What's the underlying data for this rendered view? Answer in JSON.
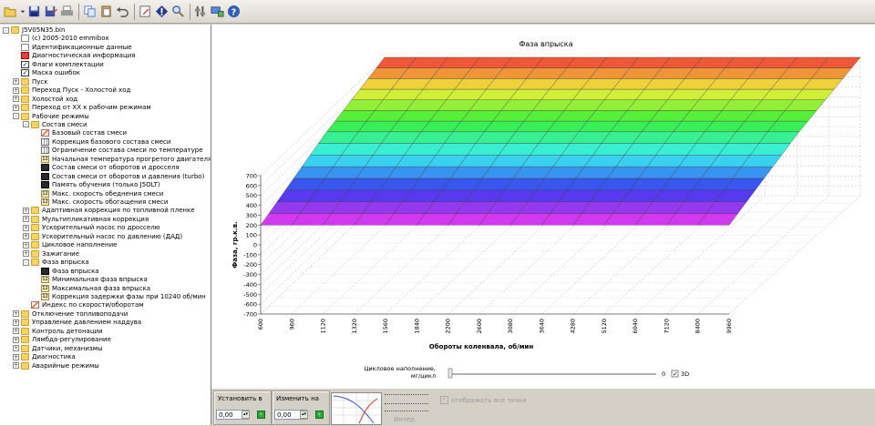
{
  "toolbar": {
    "icons": [
      "open-icon",
      "dropdown-arrow-icon",
      "save-icon",
      "save-as-icon",
      "print-icon",
      "copy-icon",
      "paste-icon",
      "undo-icon",
      "edit-icon",
      "warning-icon",
      "search-icon",
      "settings-icon",
      "connect-icon",
      "help-icon"
    ]
  },
  "tree": {
    "items": [
      {
        "label": "J5V05N35.bin",
        "level": 0,
        "icon": "floppy-icon",
        "exp": "-"
      },
      {
        "label": "(c) 2005-2010 emmibox",
        "level": 1,
        "icon": "file-icon",
        "exp": ""
      },
      {
        "label": "Идентификационные данные",
        "level": 1,
        "icon": "file-icon",
        "exp": ""
      },
      {
        "label": "Диагностическая информация",
        "level": 1,
        "icon": "chip-icon",
        "exp": ""
      },
      {
        "label": "Флаги комплектации",
        "level": 1,
        "icon": "check-icon",
        "exp": ""
      },
      {
        "label": "Маска ошибок",
        "level": 1,
        "icon": "check-icon",
        "exp": ""
      },
      {
        "label": "Пуск",
        "level": 1,
        "icon": "folder-icon",
        "exp": "+"
      },
      {
        "label": "Переход Пуск - Холостой ход",
        "level": 1,
        "icon": "folder-icon",
        "exp": "+"
      },
      {
        "label": "Холостой ход",
        "level": 1,
        "icon": "folder-icon",
        "exp": "+"
      },
      {
        "label": "Переход от ХХ к рабочим режимам",
        "level": 1,
        "icon": "folder-icon",
        "exp": "+"
      },
      {
        "label": "Рабочие режимы",
        "level": 1,
        "icon": "folder-icon",
        "exp": "-"
      },
      {
        "label": "Состав смеси",
        "level": 2,
        "icon": "folder-icon",
        "exp": "-"
      },
      {
        "label": "Базовый состав смеси",
        "level": 3,
        "icon": "pencil-icon",
        "exp": ""
      },
      {
        "label": "Коррекция базового состава смеси",
        "level": 3,
        "icon": "grid-icon",
        "exp": ""
      },
      {
        "label": "Ограничение состава смеси по температуре",
        "level": 3,
        "icon": "grid-icon",
        "exp": ""
      },
      {
        "label": "Начальная температура прогретого двигателя",
        "level": 3,
        "icon": "num-icon",
        "exp": ""
      },
      {
        "label": "Состав смеси от оборотов и дросселя",
        "level": 3,
        "icon": "map-icon",
        "exp": ""
      },
      {
        "label": "Состав смеси от оборотов и давления (turbo)",
        "level": 3,
        "icon": "map-icon",
        "exp": ""
      },
      {
        "label": "Память обучения (только J5OLT)",
        "level": 3,
        "icon": "map-icon",
        "exp": ""
      },
      {
        "label": "Макс. скорость обеднения смеси",
        "level": 3,
        "icon": "num-icon",
        "exp": ""
      },
      {
        "label": "Макс. скорость обогащения смеси",
        "level": 3,
        "icon": "num-icon",
        "exp": ""
      },
      {
        "label": "Адаптивная коррекция по топливной пленке",
        "level": 2,
        "icon": "folder-icon",
        "exp": "+"
      },
      {
        "label": "Мультипликативная коррекция",
        "level": 2,
        "icon": "folder-icon",
        "exp": "+"
      },
      {
        "label": "Ускорительный насос по дросселю",
        "level": 2,
        "icon": "folder-icon",
        "exp": "+"
      },
      {
        "label": "Ускорительный насос по давлению (ДАД)",
        "level": 2,
        "icon": "folder-icon",
        "exp": "+"
      },
      {
        "label": "Цикловое наполнение",
        "level": 2,
        "icon": "folder-icon",
        "exp": "+"
      },
      {
        "label": "Зажигание",
        "level": 2,
        "icon": "folder-icon",
        "exp": "+"
      },
      {
        "label": "Фаза впрыска",
        "level": 2,
        "icon": "folder-icon",
        "exp": "-"
      },
      {
        "label": "Фаза впрыска",
        "level": 3,
        "icon": "map-icon",
        "exp": ""
      },
      {
        "label": "Минимальная фаза впрыска",
        "level": 3,
        "icon": "num-icon",
        "exp": ""
      },
      {
        "label": "Максимальная фаза впрыска",
        "level": 3,
        "icon": "num-icon",
        "exp": ""
      },
      {
        "label": "Коррекция задержки фазы при 10240 об/мин",
        "level": 3,
        "icon": "num-icon",
        "exp": ""
      },
      {
        "label": "Индекс по скорости/оборотам",
        "level": 2,
        "icon": "pencil-icon",
        "exp": ""
      },
      {
        "label": "Отключение топливоподачи",
        "level": 1,
        "icon": "folder-icon",
        "exp": "+"
      },
      {
        "label": "Управление давлением наддува",
        "level": 1,
        "icon": "folder-icon",
        "exp": "+"
      },
      {
        "label": "Контроль детонации",
        "level": 1,
        "icon": "folder-icon",
        "exp": "+"
      },
      {
        "label": "Лямбда-регулирование",
        "level": 1,
        "icon": "folder-icon",
        "exp": "+"
      },
      {
        "label": "Датчики, механизмы",
        "level": 1,
        "icon": "folder-icon",
        "exp": "+"
      },
      {
        "label": "Диагностика",
        "level": 1,
        "icon": "folder-icon",
        "exp": "+"
      },
      {
        "label": "Аварийные режимы",
        "level": 1,
        "icon": "folder-icon",
        "exp": "+"
      }
    ]
  },
  "chart_data": {
    "type": "surface",
    "title": "Фаза впрыска",
    "xlabel": "Обороты коленвала, об/мин",
    "ylabel": "Фаза, гр.к.в.",
    "x_ticks": [
      "600",
      "960",
      "1120",
      "1320",
      "1560",
      "1840",
      "2200",
      "2600",
      "3080",
      "3640",
      "4280",
      "5120",
      "6040",
      "7120",
      "8400",
      "9960"
    ],
    "z_ticks": [
      "700",
      "600",
      "500",
      "400",
      "300",
      "200",
      "100",
      "0",
      "-100",
      "-200",
      "-300",
      "-400",
      "-500",
      "-600",
      "-700"
    ],
    "zlim": [
      -700,
      700
    ],
    "surface_low_band": [
      200,
      500
    ],
    "surface_high_band": [
      500,
      700
    ],
    "mode_3d": true
  },
  "slider": {
    "label_line1": "Цикловое наполнение,",
    "label_line2": "мг/цикл",
    "value": "0",
    "check_3d_label": "3D"
  },
  "bottom": {
    "set_label": "Установить в",
    "set_value": "0,00",
    "change_label": "Изменить на",
    "change_value": "0,00",
    "show_all_label": "отображать все точки",
    "interp_label": "Интер."
  }
}
